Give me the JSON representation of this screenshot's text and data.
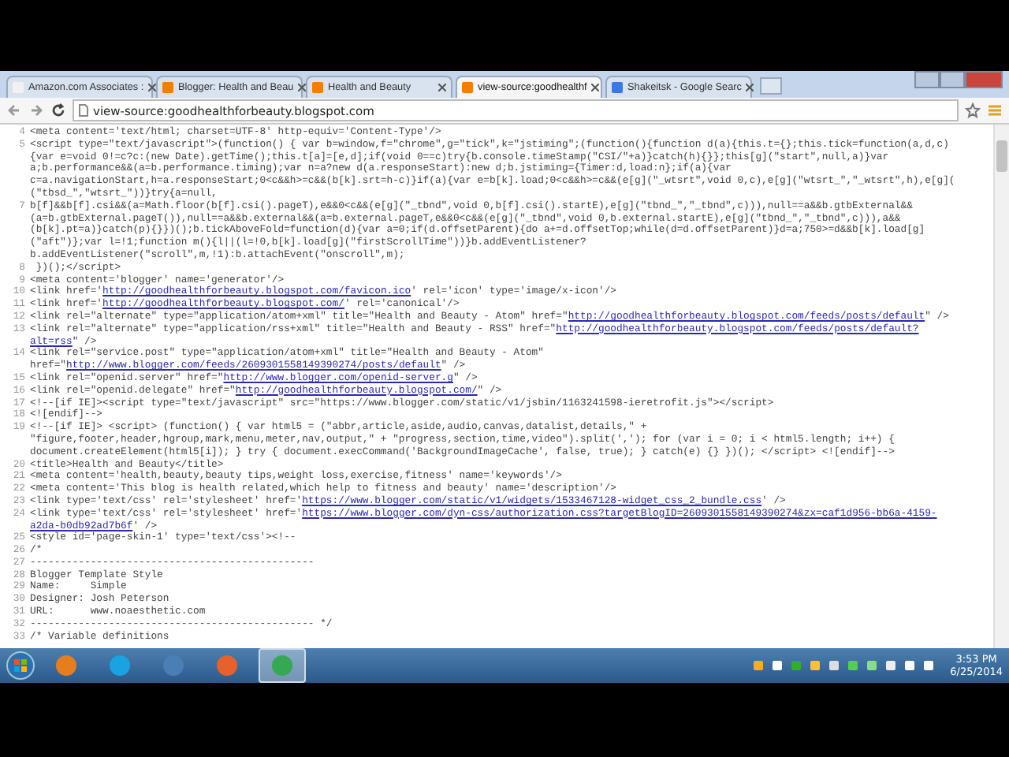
{
  "browser": {
    "tabs": [
      {
        "title": "Amazon.com Associates :",
        "color": "#f2f2f2",
        "selected": false
      },
      {
        "title": "Blogger: Health and Beau",
        "color": "#f57d00",
        "selected": false
      },
      {
        "title": "Health and Beauty",
        "color": "#f57d00",
        "selected": false
      },
      {
        "title": "view-source:goodhealthf",
        "color": "#f57d00",
        "selected": true
      },
      {
        "title": "Shakeitsk - Google Searc",
        "color": "#3b78e7",
        "selected": false
      }
    ],
    "address": "view-source:goodhealthforbeauty.blogspot.com"
  },
  "source": {
    "lines": [
      {
        "number": "4",
        "rows": [
          {
            "parts": [
              {
                "kind": "code",
                "text": "<meta content='text/html; charset=UTF-8' http-equiv='Content-Type'/>"
              }
            ]
          }
        ]
      },
      {
        "number": "5",
        "rows": [
          {
            "parts": [
              {
                "kind": "code",
                "text": "<script type=\"text/javascript\">(function() { var b=window,f=\"chrome\",g=\"tick\",k=\"jstiming\";(function(){function d(a){this.t={};this.tick=function(a,d,c)"
              }
            ]
          },
          {
            "parts": [
              {
                "kind": "code",
                "text": "{var e=void 0!=c?c:(new Date).getTime();this.t[a]=[e,d];if(void 0==c)try{b.console.timeStamp(\"CSI/\"+a)}catch(h){}};this[g](\"start\",null,a)}var"
              }
            ]
          },
          {
            "parts": [
              {
                "kind": "code",
                "text": "a;b.performance&&(a=b.performance.timing);var n=a?new d(a.responseStart):new d;b.jstiming={Timer:d,load:n};if(a){var"
              }
            ]
          },
          {
            "parts": [
              {
                "kind": "code",
                "text": "c=a.navigationStart,h=a.responseStart;0<c&&h>=c&&(b[k].srt=h-c)}if(a){var e=b[k].load;0<c&&h>=c&&(e[g](\"_wtsrt\",void 0,c),e[g](\"wtsrt_\",\"_wtsrt\",h),e[g]("
              }
            ]
          },
          {
            "parts": [
              {
                "kind": "code",
                "text": "(\"tbsd_\",\"wtsrt_\"))}try{a=null,"
              }
            ]
          }
        ]
      },
      {
        "number": "7",
        "rows": [
          {
            "parts": [
              {
                "kind": "code",
                "text": "b[f]&&b[f].csi&&(a=Math.floor(b[f].csi().pageT),e&&0<c&&(e[g](\"_tbnd\",void 0,b[f].csi().startE),e[g](\"tbnd_\",\"_tbnd\",c))),null==a&&b.gtbExternal&&"
              }
            ]
          },
          {
            "parts": [
              {
                "kind": "code",
                "text": "(a=b.gtbExternal.pageT()),null==a&&b.external&&(a=b.external.pageT,e&&0<c&&(e[g](\"_tbnd\",void 0,b.external.startE),e[g](\"tbnd_\",\"_tbnd\",c))),a&&"
              }
            ]
          },
          {
            "parts": [
              {
                "kind": "code",
                "text": "(b[k].pt=a)}catch(p){}})();b.tickAboveFold=function(d){var a=0;if(d.offsetParent){do a+=d.offsetTop;while(d=d.offsetParent)}d=a;750>=d&&b[k].load[g]"
              }
            ]
          },
          {
            "parts": [
              {
                "kind": "code",
                "text": "(\"aft\")};var l=!1;function m(){l||(l=!0,b[k].load[g](\"firstScrollTime\"))}b.addEventListener?"
              }
            ]
          },
          {
            "parts": [
              {
                "kind": "code",
                "text": "b.addEventListener(\"scroll\",m,!1):b.attachEvent(\"onscroll\",m);"
              }
            ]
          }
        ]
      },
      {
        "number": "8",
        "rows": [
          {
            "parts": [
              {
                "kind": "code",
                "text": " })();</script>"
              }
            ]
          }
        ]
      },
      {
        "number": "9",
        "rows": [
          {
            "parts": [
              {
                "kind": "code",
                "text": "<meta content='blogger' name='generator'/>"
              }
            ]
          }
        ]
      },
      {
        "number": "10",
        "rows": [
          {
            "parts": [
              {
                "kind": "code",
                "text": "<link href='"
              },
              {
                "kind": "link",
                "text": "http://goodhealthforbeauty.blogspot.com/favicon.ico"
              },
              {
                "kind": "code",
                "text": "' rel='icon' type='image/x-icon'/>"
              }
            ]
          }
        ]
      },
      {
        "number": "11",
        "rows": [
          {
            "parts": [
              {
                "kind": "code",
                "text": "<link href='"
              },
              {
                "kind": "link",
                "text": "http://goodhealthforbeauty.blogspot.com/"
              },
              {
                "kind": "code",
                "text": "' rel='canonical'/>"
              }
            ]
          }
        ]
      },
      {
        "number": "12",
        "rows": [
          {
            "parts": [
              {
                "kind": "code",
                "text": "<link rel=\"alternate\" type=\"application/atom+xml\" title=\"Health and Beauty - Atom\" href=\""
              },
              {
                "kind": "link",
                "text": "http://goodhealthforbeauty.blogspot.com/feeds/posts/default"
              },
              {
                "kind": "code",
                "text": "\" />"
              }
            ]
          }
        ]
      },
      {
        "number": "13",
        "rows": [
          {
            "parts": [
              {
                "kind": "code",
                "text": "<link rel=\"alternate\" type=\"application/rss+xml\" title=\"Health and Beauty - RSS\" href=\""
              },
              {
                "kind": "link",
                "text": "http://goodhealthforbeauty.blogspot.com/feeds/posts/default?"
              }
            ]
          },
          {
            "parts": [
              {
                "kind": "link",
                "text": "alt=rss"
              },
              {
                "kind": "code",
                "text": "\" />"
              }
            ]
          }
        ]
      },
      {
        "number": "14",
        "rows": [
          {
            "parts": [
              {
                "kind": "code",
                "text": "<link rel=\"service.post\" type=\"application/atom+xml\" title=\"Health and Beauty - Atom\""
              }
            ]
          },
          {
            "parts": [
              {
                "kind": "code",
                "text": "href=\""
              },
              {
                "kind": "link",
                "text": "http://www.blogger.com/feeds/2609301558149390274/posts/default"
              },
              {
                "kind": "code",
                "text": "\" />"
              }
            ]
          }
        ]
      },
      {
        "number": "15",
        "rows": [
          {
            "parts": [
              {
                "kind": "code",
                "text": "<link rel=\"openid.server\" href=\""
              },
              {
                "kind": "link",
                "text": "http://www.blogger.com/openid-server.g"
              },
              {
                "kind": "code",
                "text": "\" />"
              }
            ]
          }
        ]
      },
      {
        "number": "16",
        "rows": [
          {
            "parts": [
              {
                "kind": "code",
                "text": "<link rel=\"openid.delegate\" href=\""
              },
              {
                "kind": "link",
                "text": "http://goodhealthforbeauty.blogspot.com/"
              },
              {
                "kind": "code",
                "text": "\" />"
              }
            ]
          }
        ]
      },
      {
        "number": "17",
        "rows": [
          {
            "parts": [
              {
                "kind": "code",
                "text": "<!--[if IE]><script type=\"text/javascript\" src=\"https://www.blogger.com/static/v1/jsbin/1163241598-ieretrofit.js\"></script>"
              }
            ]
          }
        ]
      },
      {
        "number": "18",
        "rows": [
          {
            "parts": [
              {
                "kind": "code",
                "text": "<![endif]-->"
              }
            ]
          }
        ]
      },
      {
        "number": "19",
        "rows": [
          {
            "parts": [
              {
                "kind": "code",
                "text": "<!--[if IE]> <script> (function() { var html5 = (\"abbr,article,aside,audio,canvas,datalist,details,\" +"
              }
            ]
          },
          {
            "parts": [
              {
                "kind": "code",
                "text": "\"figure,footer,header,hgroup,mark,menu,meter,nav,output,\" + \"progress,section,time,video\").split(','); for (var i = 0; i < html5.length; i++) {"
              }
            ]
          },
          {
            "parts": [
              {
                "kind": "code",
                "text": "document.createElement(html5[i]); } try { document.execCommand('BackgroundImageCache', false, true); } catch(e) {} })(); </script> <![endif]-->"
              }
            ]
          }
        ]
      },
      {
        "number": "20",
        "rows": [
          {
            "parts": [
              {
                "kind": "code",
                "text": "<title>Health and Beauty</title>"
              }
            ]
          }
        ]
      },
      {
        "number": "21",
        "rows": [
          {
            "parts": [
              {
                "kind": "code",
                "text": "<meta content='health,beauty,beauty tips,weight loss,exercise,fitness' name='keywords'/>"
              }
            ]
          }
        ]
      },
      {
        "number": "22",
        "rows": [
          {
            "parts": [
              {
                "kind": "code",
                "text": "<meta content='This blog is health related,which help to fitness and beauty' name='description'/>"
              }
            ]
          }
        ]
      },
      {
        "number": "23",
        "rows": [
          {
            "parts": [
              {
                "kind": "code",
                "text": "<link type='text/css' rel='stylesheet' href='"
              },
              {
                "kind": "link",
                "text": "https://www.blogger.com/static/v1/widgets/1533467128-widget_css_2_bundle.css"
              },
              {
                "kind": "code",
                "text": "' />"
              }
            ]
          }
        ]
      },
      {
        "number": "24",
        "rows": [
          {
            "parts": [
              {
                "kind": "code",
                "text": "<link type='text/css' rel='stylesheet' href='"
              },
              {
                "kind": "link",
                "text": "https://www.blogger.com/dyn-css/authorization.css?targetBlogID=2609301558149390274&zx=caf1d956-bb6a-4159-"
              }
            ]
          },
          {
            "parts": [
              {
                "kind": "link",
                "text": "a2da-b0db92ad7b6f"
              },
              {
                "kind": "code",
                "text": "' />"
              }
            ]
          }
        ]
      },
      {
        "number": "25",
        "rows": [
          {
            "parts": [
              {
                "kind": "code",
                "text": "<style id='page-skin-1' type='text/css'><!--"
              }
            ]
          }
        ]
      },
      {
        "number": "26",
        "rows": [
          {
            "parts": [
              {
                "kind": "code",
                "text": "/*"
              }
            ]
          }
        ]
      },
      {
        "number": "27",
        "rows": [
          {
            "parts": [
              {
                "kind": "code",
                "text": "-----------------------------------------------"
              }
            ]
          }
        ]
      },
      {
        "number": "28",
        "rows": [
          {
            "parts": [
              {
                "kind": "code",
                "text": "Blogger Template Style"
              }
            ]
          }
        ]
      },
      {
        "number": "29",
        "rows": [
          {
            "parts": [
              {
                "kind": "code",
                "text": "Name:     Simple"
              }
            ]
          }
        ]
      },
      {
        "number": "30",
        "rows": [
          {
            "parts": [
              {
                "kind": "code",
                "text": "Designer: Josh Peterson"
              }
            ]
          }
        ]
      },
      {
        "number": "31",
        "rows": [
          {
            "parts": [
              {
                "kind": "code",
                "text": "URL:      www.noaesthetic.com"
              }
            ]
          }
        ]
      },
      {
        "number": "32",
        "rows": [
          {
            "parts": [
              {
                "kind": "code",
                "text": "----------------------------------------------- */"
              }
            ]
          }
        ]
      },
      {
        "number": "33",
        "rows": [
          {
            "parts": [
              {
                "kind": "code",
                "text": "/* Variable definitions"
              }
            ]
          }
        ]
      }
    ]
  },
  "taskbar": {
    "apps": [
      {
        "color": "#e87d1e",
        "selected": false
      },
      {
        "color": "#1aa3e0",
        "selected": false
      },
      {
        "color": "#4a7fb5",
        "selected": false
      },
      {
        "color": "#e8612c",
        "selected": false
      },
      {
        "color": "#34a853",
        "selected": true
      }
    ],
    "time": "3:53 PM",
    "date": "6/25/2014"
  }
}
